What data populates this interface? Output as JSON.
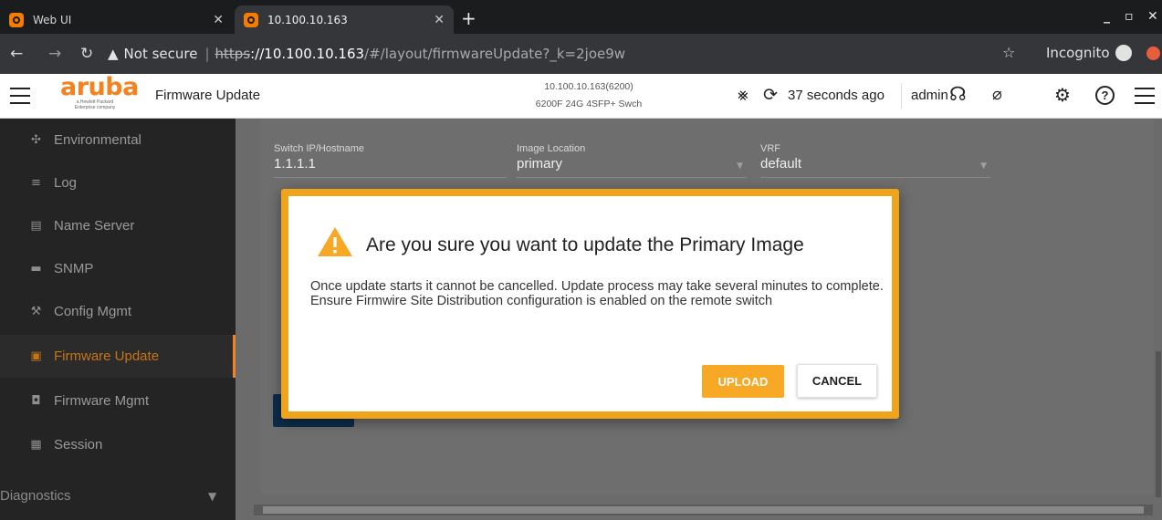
{
  "browser": {
    "tabs": [
      {
        "title": "Web UI",
        "active": false
      },
      {
        "title": "10.100.10.163",
        "active": true
      }
    ],
    "new_tab": "+",
    "address": {
      "security_icon": "warning-triangle-icon",
      "security_label": "Not secure",
      "scheme": "https",
      "host": "://10.100.10.163",
      "path": "/#/layout/firmwareUpdate?_k=2joe9w"
    },
    "incognito_label": "Incognito"
  },
  "header": {
    "logo_text": "aruba",
    "logo_subtext": "a Hewlett Packard Enterprise company",
    "page_title": "Firmware Update",
    "device_line1": "10.100.10.163(6200)",
    "device_line2": "6200F 24G 4SFP+ Swch",
    "refresh_text": "37 seconds ago",
    "user": "admin"
  },
  "sidebar": {
    "items": [
      {
        "label": "Environmental",
        "icon": "fan-icon",
        "active": false
      },
      {
        "label": "Log",
        "icon": "list-icon",
        "active": false
      },
      {
        "label": "Name Server",
        "icon": "server-icon",
        "active": false
      },
      {
        "label": "SNMP",
        "icon": "snmp-icon",
        "active": false
      },
      {
        "label": "Config Mgmt",
        "icon": "wrench-icon",
        "active": false
      },
      {
        "label": "Firmware Update",
        "icon": "firmware-update-icon",
        "active": true
      },
      {
        "label": "Firmware Mgmt",
        "icon": "firmware-mgmt-icon",
        "active": false
      },
      {
        "label": "Session",
        "icon": "clipboard-icon",
        "active": false
      }
    ],
    "section": {
      "label": "Diagnostics"
    }
  },
  "form": {
    "switch": {
      "label": "Switch IP/Hostname",
      "value": "1.1.1.1"
    },
    "image_location": {
      "label": "Image Location",
      "value": "primary"
    },
    "vrf": {
      "label": "VRF",
      "value": "default"
    }
  },
  "modal": {
    "title": "Are you sure you want to update the Primary Image",
    "body_line1": "Once update starts it cannot be cancelled. Update process may take several minutes to complete.",
    "body_line2": "Ensure Firmwire Site Distribution configuration is enabled on the remote switch",
    "upload_label": "UPLOAD",
    "cancel_label": "CANCEL"
  },
  "colors": {
    "brand": "#f58220",
    "modal_border": "#f0a41c",
    "upload_button": "#f7a825",
    "sidebar_bg": "#242424"
  }
}
